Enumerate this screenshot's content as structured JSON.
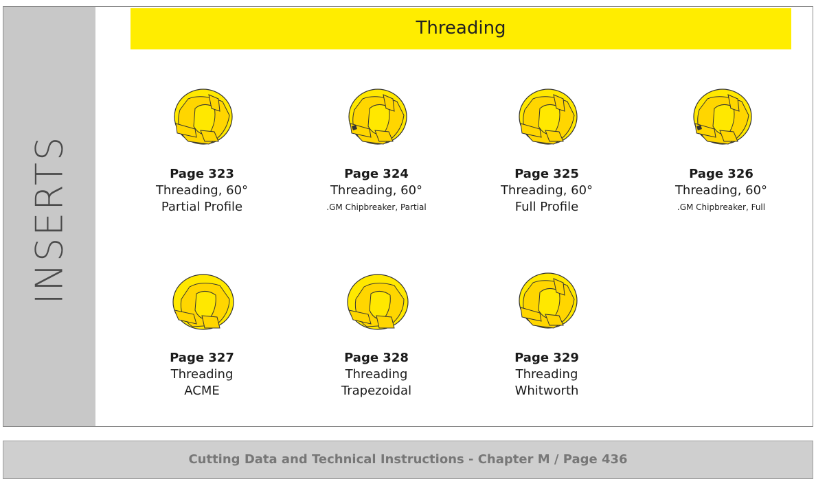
{
  "side_label": "INSERTS",
  "header": {
    "title": "Threading"
  },
  "colors": {
    "accent": "#ffed00",
    "insert_fill": "#ffe800",
    "sidebar": "#c8c8c8"
  },
  "cards": [
    {
      "page": "Page 323",
      "line1": "Threading, 60°",
      "line2": "Partial Profile",
      "icon": "threading-insert-icon"
    },
    {
      "page": "Page 324",
      "line1": "Threading, 60°",
      "line2": ".GM Chipbreaker, Partial",
      "icon": "threading-insert-icon"
    },
    {
      "page": "Page 325",
      "line1": "Threading, 60°",
      "line2": "Full Profile",
      "icon": "threading-insert-icon"
    },
    {
      "page": "Page 326",
      "line1": "Threading, 60°",
      "line2": ".GM Chipbreaker, Full",
      "icon": "threading-insert-icon"
    },
    {
      "page": "Page 327",
      "line1": "Threading",
      "line2": "ACME",
      "icon": "threading-insert-icon"
    },
    {
      "page": "Page 328",
      "line1": "Threading",
      "line2": "Trapezoidal",
      "icon": "threading-insert-icon"
    },
    {
      "page": "Page 329",
      "line1": "Threading",
      "line2": "Whitworth",
      "icon": "threading-insert-icon"
    }
  ],
  "footer": {
    "text": "Cutting Data and Technical Instructions - Chapter M / Page 436"
  }
}
